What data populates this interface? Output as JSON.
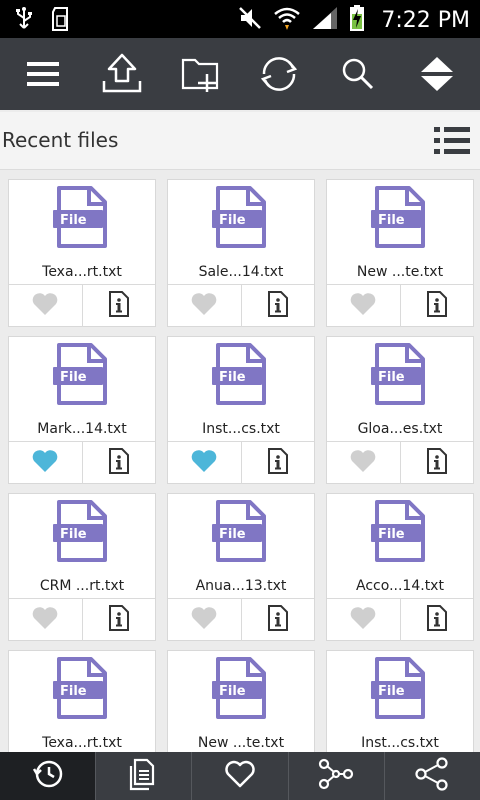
{
  "status_bar": {
    "time": "7:22 PM",
    "icons": [
      "usb-icon",
      "sd-card-icon",
      "mute-icon",
      "wifi-icon",
      "signal-icon",
      "battery-charging-icon"
    ]
  },
  "toolbar": {
    "buttons": [
      "menu-icon",
      "upload-icon",
      "new-folder-icon",
      "sync-icon",
      "search-icon",
      "sort-icon"
    ]
  },
  "header": {
    "title": "Recent files",
    "view_toggle": "list-view-icon"
  },
  "file_icon_label": "File",
  "files": [
    {
      "name": "Texa...rt.txt",
      "favorite": false
    },
    {
      "name": "Sale...14.txt",
      "favorite": false
    },
    {
      "name": "New ...te.txt",
      "favorite": false
    },
    {
      "name": "Mark...14.txt",
      "favorite": true
    },
    {
      "name": "Inst...cs.txt",
      "favorite": true
    },
    {
      "name": "Gloa...es.txt",
      "favorite": false
    },
    {
      "name": "CRM ...rt.txt",
      "favorite": false
    },
    {
      "name": "Anua...13.txt",
      "favorite": false
    },
    {
      "name": "Acco...14.txt",
      "favorite": false
    },
    {
      "name": "Texa...rt.txt",
      "favorite": false
    },
    {
      "name": "New ...te.txt",
      "favorite": false
    },
    {
      "name": "Inst...cs.txt",
      "favorite": false
    }
  ],
  "colors": {
    "favorite_on": "#4db6d9",
    "favorite_off": "#cfcfcf",
    "file_icon": "#8076c4",
    "toolbar_bg": "#3a3d42"
  },
  "bottom_nav": {
    "items": [
      "recent-icon",
      "documents-icon",
      "favorites-icon",
      "network-icon",
      "share-icon"
    ],
    "active_index": 0
  }
}
